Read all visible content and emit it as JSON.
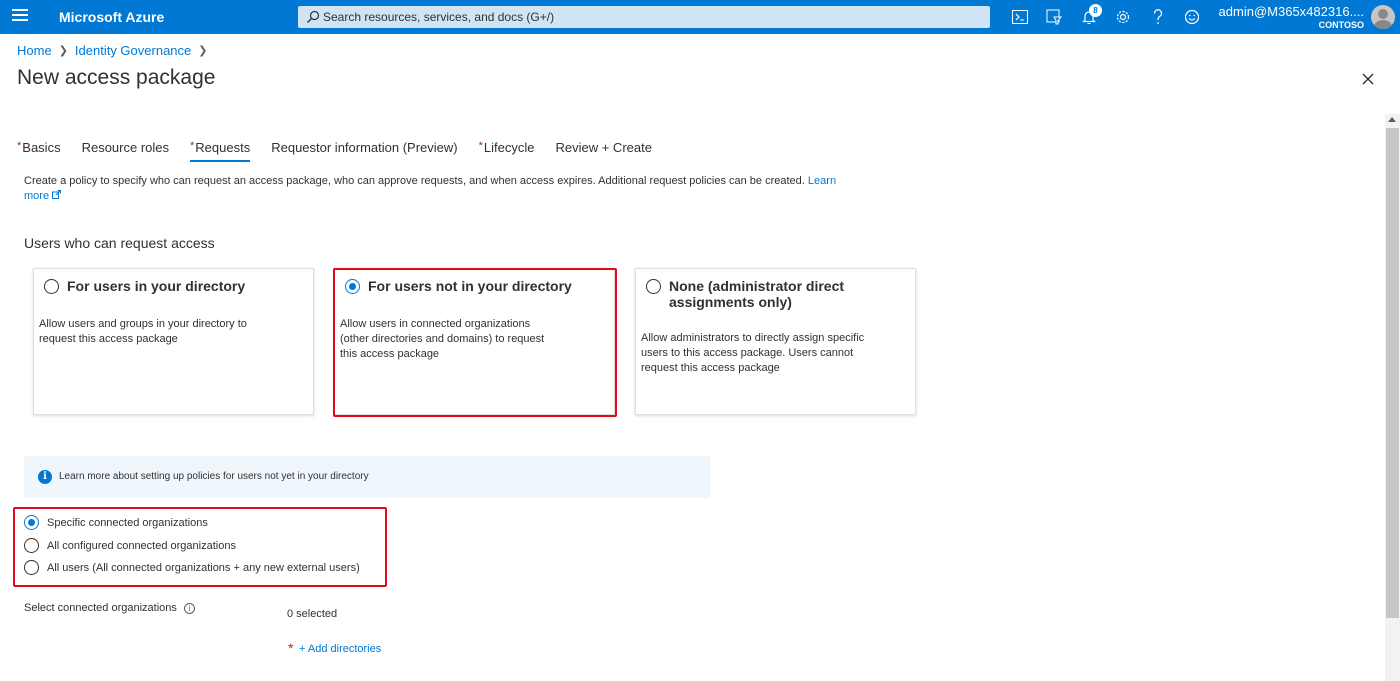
{
  "topbar": {
    "brand": "Microsoft Azure",
    "search_placeholder": "Search resources, services, and docs (G+/)",
    "notification_count": "8",
    "user_email": "admin@M365x482316....",
    "user_tenant": "CONTOSO",
    "icons": [
      "menu-icon",
      "cloud-shell-icon",
      "directory-filter-icon",
      "notifications-icon",
      "settings-icon",
      "help-icon",
      "feedback-icon"
    ]
  },
  "breadcrumb": {
    "items": [
      "Home",
      "Identity Governance"
    ]
  },
  "page": {
    "title": "New access package"
  },
  "tabs": [
    {
      "label": "Basics",
      "required": true,
      "active": false
    },
    {
      "label": "Resource roles",
      "required": false,
      "active": false
    },
    {
      "label": "Requests",
      "required": true,
      "active": true
    },
    {
      "label": "Requestor information (Preview)",
      "required": false,
      "active": false
    },
    {
      "label": "Lifecycle",
      "required": true,
      "active": false
    },
    {
      "label": "Review + Create",
      "required": false,
      "active": false
    }
  ],
  "required_mark": "*",
  "description": {
    "text": "Create a policy to specify who can request an access package, who can approve requests, and when access expires. Additional request policies can be created.",
    "link": "Learn more"
  },
  "section": {
    "title": "Users who can request access"
  },
  "cards": [
    {
      "title": "For users in your directory",
      "body": "Allow users and groups in your directory to request this access package",
      "selected": false
    },
    {
      "title": "For users not in your directory",
      "body": "Allow users in connected organizations (other directories and domains) to request this access package",
      "selected": true
    },
    {
      "title": "None (administrator direct assignments only)",
      "body": "Allow administrators to directly assign specific users to this access package. Users cannot request this access package",
      "selected": false
    }
  ],
  "info_banner": {
    "text": "Learn more about setting up policies for users not yet in your directory"
  },
  "scope_options": [
    {
      "label": "Specific connected organizations",
      "selected": true
    },
    {
      "label": "All configured connected organizations",
      "selected": false
    },
    {
      "label": "All users (All connected organizations + any new external users)",
      "selected": false
    }
  ],
  "connected_orgs": {
    "label": "Select connected organizations",
    "selected_text": "0 selected",
    "add_link": "+ Add directories"
  },
  "colors": {
    "azure_blue": "#0078d4",
    "highlight_red": "#e00b1c",
    "required_red": "#a4262c",
    "info_bg": "#eff6fc"
  }
}
